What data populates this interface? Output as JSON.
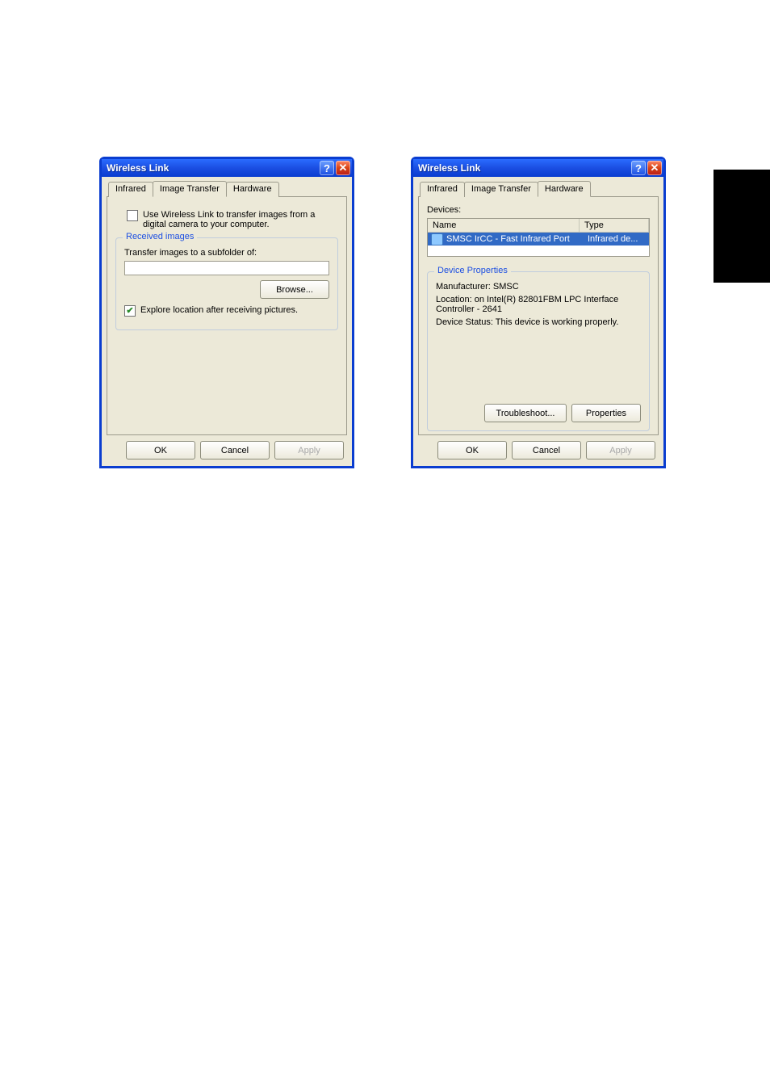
{
  "left": {
    "title": "Wireless Link",
    "tabs": {
      "infrared": "Infrared",
      "image_transfer": "Image Transfer",
      "hardware": "Hardware",
      "active": "image_transfer"
    },
    "use_wireless_label": "Use Wireless Link to transfer images from a digital camera to your computer.",
    "use_wireless_checked": false,
    "group_received": "Received images",
    "transfer_label": "Transfer images to a subfolder of:",
    "path_value": "",
    "browse": "Browse...",
    "explore_label": "Explore location after receiving pictures.",
    "explore_checked": true,
    "ok": "OK",
    "cancel": "Cancel",
    "apply": "Apply"
  },
  "right": {
    "title": "Wireless Link",
    "tabs": {
      "infrared": "Infrared",
      "image_transfer": "Image Transfer",
      "hardware": "Hardware",
      "active": "hardware"
    },
    "devices_label": "Devices:",
    "col_name": "Name",
    "col_type": "Type",
    "device_name": "SMSC IrCC - Fast Infrared Port",
    "device_type": "Infrared de...",
    "group_props": "Device Properties",
    "manufacturer": "Manufacturer: SMSC",
    "location": "Location: on Intel(R) 82801FBM LPC Interface Controller - 2641",
    "status": "Device Status: This device is working properly.",
    "troubleshoot": "Troubleshoot...",
    "properties": "Properties",
    "ok": "OK",
    "cancel": "Cancel",
    "apply": "Apply"
  }
}
